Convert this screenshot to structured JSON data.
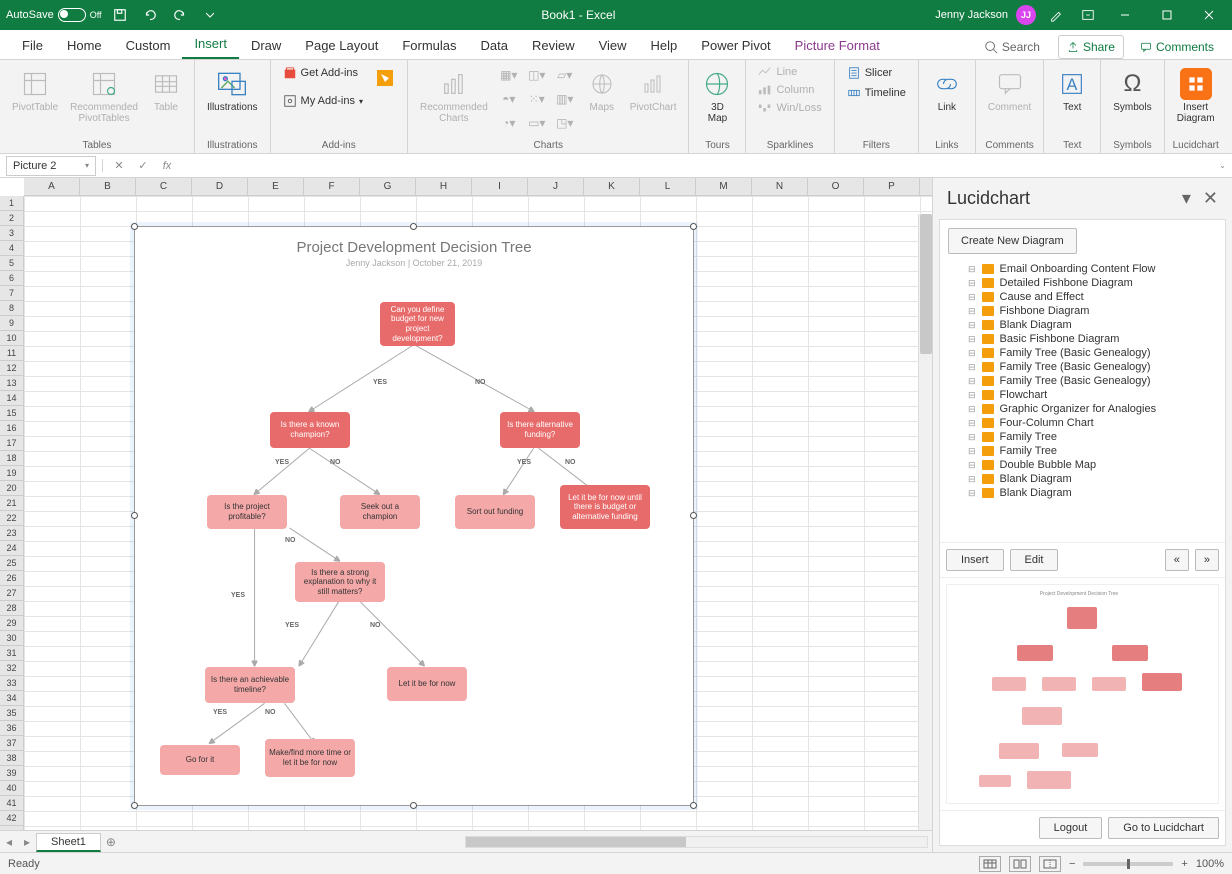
{
  "titlebar": {
    "autosave_label": "AutoSave",
    "autosave_state": "Off",
    "doc_title": "Book1 - Excel",
    "user_name": "Jenny Jackson",
    "user_initials": "JJ"
  },
  "tabs": {
    "list": [
      "File",
      "Home",
      "Custom",
      "Insert",
      "Draw",
      "Page Layout",
      "Formulas",
      "Data",
      "Review",
      "View",
      "Help",
      "Power Pivot",
      "Picture Format"
    ],
    "active": "Insert",
    "search_placeholder": "Search",
    "share": "Share",
    "comments": "Comments"
  },
  "ribbon": {
    "tables": {
      "label": "Tables",
      "pivot": "PivotTable",
      "rec": "Recommended\nPivotTables",
      "table": "Table"
    },
    "illus": {
      "label": "Illustrations",
      "btn": "Illustrations"
    },
    "addins": {
      "label": "Add-ins",
      "get": "Get Add-ins",
      "my": "My Add-ins"
    },
    "charts": {
      "label": "Charts",
      "rec": "Recommended\nCharts",
      "maps": "Maps",
      "pivotchart": "PivotChart"
    },
    "tours": {
      "label": "Tours",
      "map3d": "3D\nMap"
    },
    "spark": {
      "label": "Sparklines",
      "line": "Line",
      "col": "Column",
      "wl": "Win/Loss"
    },
    "filters": {
      "label": "Filters",
      "slicer": "Slicer",
      "timeline": "Timeline"
    },
    "links": {
      "label": "Links",
      "link": "Link"
    },
    "comments": {
      "label": "Comments",
      "comment": "Comment"
    },
    "text": {
      "label": "Text",
      "btn": "Text"
    },
    "symbols": {
      "label": "Symbols",
      "btn": "Symbols"
    },
    "lucid": {
      "label": "Lucidchart",
      "btn": "Insert\nDiagram"
    }
  },
  "formula_bar": {
    "name_box": "Picture 2"
  },
  "columns": [
    "A",
    "B",
    "C",
    "D",
    "E",
    "F",
    "G",
    "H",
    "I",
    "J",
    "K",
    "L",
    "M",
    "N",
    "O",
    "P"
  ],
  "row_count": 42,
  "diagram": {
    "title": "Project Development Decision Tree",
    "subtitle": "Jenny Jackson  |  October 21, 2019",
    "nodes": {
      "root": "Can you define budget for new project development?",
      "chmp": "Is there a known champion?",
      "altf": "Is there alternative funding?",
      "prof": "Is the project profitable?",
      "seek": "Seek out a champion",
      "sort": "Sort out funding",
      "letb": "Let it be for now until there is budget or alternative funding",
      "expl": "Is there a strong explanation to why it still matters?",
      "time": "Is there an achievable timeline?",
      "let2": "Let it be for now",
      "go": "Go for it",
      "mft": "Make/find more time or let it be for now"
    },
    "labels": {
      "yes": "YES",
      "no": "NO"
    }
  },
  "sheets": {
    "active": "Sheet1"
  },
  "lucid": {
    "title": "Lucidchart",
    "create": "Create New Diagram",
    "items": [
      "Email Onboarding Content Flow",
      "Detailed Fishbone Diagram",
      "Cause and Effect",
      "Fishbone Diagram",
      "Blank Diagram",
      "Basic Fishbone Diagram",
      "Family Tree (Basic Genealogy)",
      "Family Tree (Basic Genealogy)",
      "Family Tree (Basic Genealogy)",
      "Flowchart",
      "Graphic Organizer for Analogies",
      "Four-Column Chart",
      "Family Tree",
      "Family Tree",
      "Double Bubble Map",
      "Blank Diagram",
      "Blank Diagram"
    ],
    "insert": "Insert",
    "edit": "Edit",
    "nav_prev": "«",
    "nav_next": "»",
    "logout": "Logout",
    "goto": "Go to Lucidchart",
    "preview_title": "Project Development Decision Tree"
  },
  "status": {
    "ready": "Ready",
    "zoom": "100%"
  }
}
